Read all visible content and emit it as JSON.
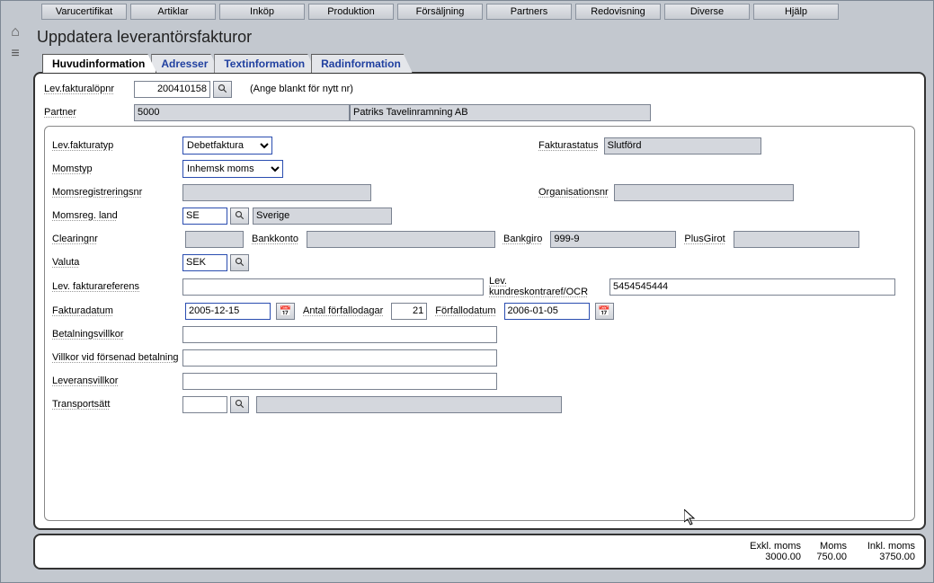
{
  "menu": [
    "Varucertifikat",
    "Artiklar",
    "Inköp",
    "Produktion",
    "Försäljning",
    "Partners",
    "Redovisning",
    "Diverse",
    "Hjälp"
  ],
  "page_title": "Uppdatera leverantörsfakturor",
  "tabs": [
    "Huvudinformation",
    "Adresser",
    "Textinformation",
    "Radinformation"
  ],
  "header": {
    "lev_fakturalopnr_label": "Lev.fakturalöpnr",
    "lev_fakturalopnr": "200410158",
    "lopnr_hint": "(Ange blankt för nytt nr)",
    "partner_label": "Partner",
    "partner_code": "5000",
    "partner_name": "Patriks Tavelinramning AB"
  },
  "form": {
    "lev_fakturatyp_label": "Lev.fakturatyp",
    "lev_fakturatyp": "Debetfaktura",
    "fakturastatus_label": "Fakturastatus",
    "fakturastatus": "Slutförd",
    "momstyp_label": "Momstyp",
    "momstyp": "Inhemsk moms",
    "momsreg_label": "Momsregistreringsnr",
    "momsreg": "",
    "orgnr_label": "Organisationsnr",
    "orgnr": "",
    "momsreg_land_label": "Momsreg. land",
    "momsreg_land_code": "SE",
    "momsreg_land_name": "Sverige",
    "clearingnr_label": "Clearingnr",
    "clearingnr": "",
    "bankkonto_label": "Bankkonto",
    "bankkonto": "",
    "bankgiro_label": "Bankgiro",
    "bankgiro": "999-9",
    "plusgirot_label": "PlusGirot",
    "plusgirot": "",
    "valuta_label": "Valuta",
    "valuta": "SEK",
    "lev_fakturaref_label": "Lev. fakturareferens",
    "lev_fakturaref": "",
    "kundres_label": "Lev. kundreskontraref/OCR",
    "kundres": "5454545444",
    "fakturadatum_label": "Fakturadatum",
    "fakturadatum": "2005-12-15",
    "antal_forfallodagar_label": "Antal förfallodagar",
    "antal_forfallodagar": "21",
    "forfallodatum_label": "Förfallodatum",
    "forfallodatum": "2006-01-05",
    "betalningsvillkor_label": "Betalningsvillkor",
    "betalningsvillkor": "",
    "villkor_forsenad_label": "Villkor vid försenad betalning",
    "villkor_forsenad": "",
    "leveransvillkor_label": "Leveransvillkor",
    "leveransvillkor": "",
    "transportsatt_label": "Transportsätt",
    "transportsatt_code": "",
    "transportsatt_name": ""
  },
  "totals": {
    "h1": "Exkl. moms",
    "h2": "Moms",
    "h3": "Inkl. moms",
    "v1": "3000.00",
    "v2": "750.00",
    "v3": "3750.00"
  }
}
